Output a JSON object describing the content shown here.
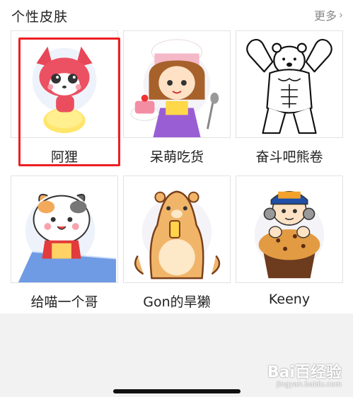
{
  "header": {
    "title": "个性皮肤",
    "more_label": "更多"
  },
  "skins": [
    {
      "label": "阿狸",
      "icon": "ali-fox-icon"
    },
    {
      "label": "呆萌吃货",
      "icon": "chef-girl-icon"
    },
    {
      "label": "奋斗吧熊卷",
      "icon": "muscle-bear-icon"
    },
    {
      "label": "给喵一个哥",
      "icon": "cat-chef-icon"
    },
    {
      "label": "Gon的旱獭",
      "icon": "marmot-icon"
    },
    {
      "label": "Keeny",
      "icon": "boy-muffin-icon"
    }
  ],
  "selected_skin": "阿狸",
  "watermark": {
    "text": "Bai百经验",
    "sub": "jingyan.baidu.com"
  },
  "colors": {
    "highlight": "#ee1f22",
    "text": "#222222",
    "muted": "#888888"
  }
}
